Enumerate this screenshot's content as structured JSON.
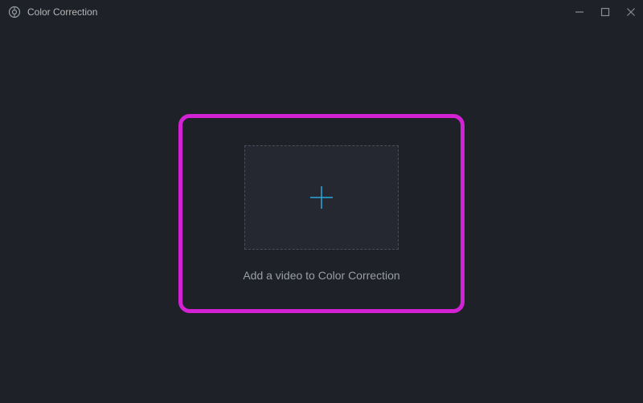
{
  "titlebar": {
    "title": "Color Correction"
  },
  "main": {
    "prompt": "Add a video to Color Correction"
  },
  "colors": {
    "highlight": "#d322d3",
    "accent": "#2aa8e0",
    "bg": "#1e2128"
  }
}
